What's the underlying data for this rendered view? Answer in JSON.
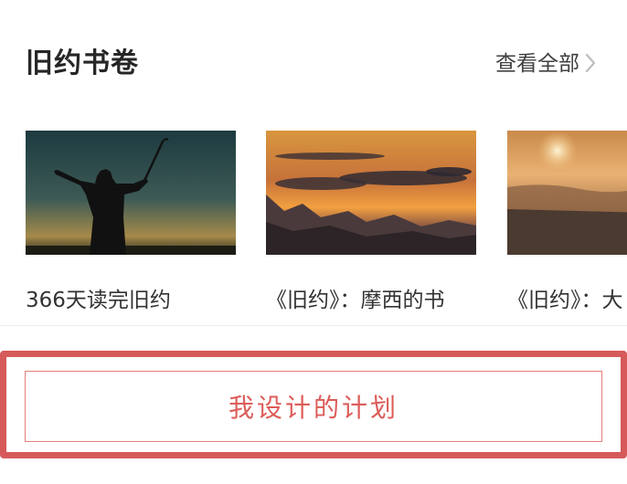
{
  "section": {
    "title": "旧约书卷",
    "view_all_label": "查看全部"
  },
  "cards": [
    {
      "caption": "366天读完旧约",
      "image": "silhouette-raising-staff-at-dusk"
    },
    {
      "caption": "《旧约》：摩西的书",
      "image": "sunset-over-mountains"
    },
    {
      "caption": "《旧约》：大",
      "image": "hazy-sunrise-over-fields"
    }
  ],
  "plan_button": {
    "label": "我设计的计划"
  },
  "colors": {
    "accent": "#dc5c58",
    "button_border": "#e47f7b",
    "highlight_frame": "#d65a5a"
  }
}
